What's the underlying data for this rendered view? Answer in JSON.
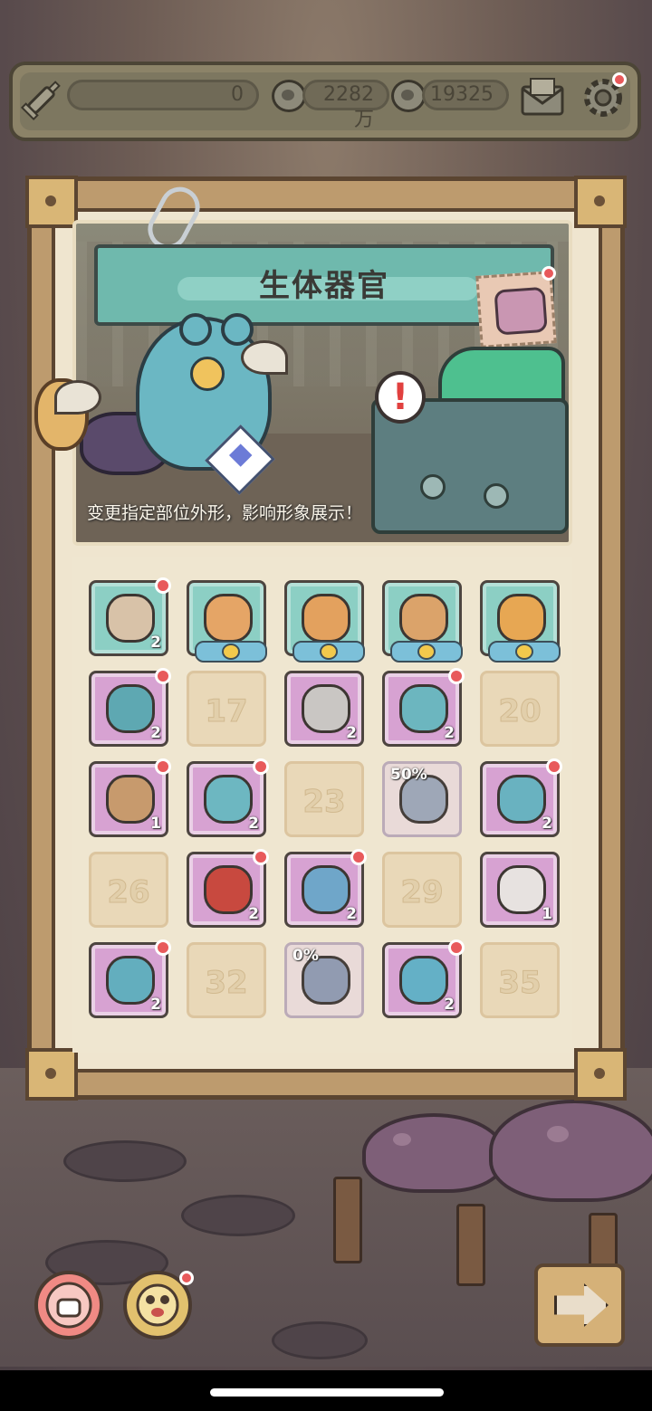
{
  "topbar": {
    "energy_value": "0",
    "currency_value": "2282万",
    "gems_value": "19325"
  },
  "panel": {
    "title": "生体器官",
    "caption": "变更指定部位外形，影响形象展示！",
    "alert_symbol": "!"
  },
  "grid": {
    "slots": [
      {
        "type": "teal",
        "count": "2",
        "badge": true,
        "wings": false,
        "art_color": "#d8c2a8"
      },
      {
        "type": "teal",
        "count": "",
        "badge": false,
        "wings": true,
        "art_color": "#e5a566"
      },
      {
        "type": "teal",
        "count": "",
        "badge": false,
        "wings": true,
        "art_color": "#e3a15e"
      },
      {
        "type": "teal",
        "count": "",
        "badge": false,
        "wings": true,
        "art_color": "#dba36a"
      },
      {
        "type": "teal",
        "count": "",
        "badge": false,
        "wings": true,
        "art_color": "#e7a753"
      },
      {
        "type": "pink",
        "count": "2",
        "badge": true,
        "wings": false,
        "art_color": "#5ea8b2"
      },
      {
        "type": "empty",
        "num": "17"
      },
      {
        "type": "pink",
        "count": "2",
        "badge": false,
        "wings": false,
        "art_color": "#c9c6c3"
      },
      {
        "type": "pink",
        "count": "2",
        "badge": true,
        "wings": false,
        "art_color": "#6cb6bf"
      },
      {
        "type": "empty",
        "num": "20"
      },
      {
        "type": "pink",
        "count": "1",
        "badge": true,
        "wings": false,
        "art_color": "#c79a6d"
      },
      {
        "type": "pink",
        "count": "2",
        "badge": true,
        "wings": false,
        "art_color": "#6db7c1"
      },
      {
        "type": "empty",
        "num": "23"
      },
      {
        "type": "ghost",
        "pct": "50%",
        "art_color": "#9aa4b6"
      },
      {
        "type": "pink",
        "count": "2",
        "badge": true,
        "wings": false,
        "art_color": "#69b2c0"
      },
      {
        "type": "empty",
        "num": "26"
      },
      {
        "type": "pink",
        "count": "2",
        "badge": true,
        "wings": false,
        "art_color": "#c8493f"
      },
      {
        "type": "pink",
        "count": "2",
        "badge": true,
        "wings": false,
        "art_color": "#6fa6c9"
      },
      {
        "type": "empty",
        "num": "29"
      },
      {
        "type": "pink",
        "count": "1",
        "badge": false,
        "wings": false,
        "art_color": "#e7e2e0"
      },
      {
        "type": "pink",
        "count": "2",
        "badge": true,
        "wings": false,
        "art_color": "#63aebe"
      },
      {
        "type": "empty",
        "num": "32"
      },
      {
        "type": "ghost",
        "pct": "0%",
        "art_color": "#8d97b0"
      },
      {
        "type": "pink",
        "count": "2",
        "badge": true,
        "wings": false,
        "art_color": "#64b0c6"
      },
      {
        "type": "empty",
        "num": "35"
      }
    ]
  },
  "colors": {
    "accent_teal": "#6fb9ad",
    "accent_pink": "#d7a2d2",
    "notification_red": "#e85a5c",
    "frame_brown": "#5b4531"
  },
  "icons": {
    "topbar": [
      "syringe-icon",
      "speech-bubble-icon",
      "speech-bubble-icon",
      "mail-icon",
      "gear-icon"
    ],
    "bottom": [
      "organ-menu-icon",
      "monster-face-icon",
      "arrow-right-icon"
    ]
  }
}
